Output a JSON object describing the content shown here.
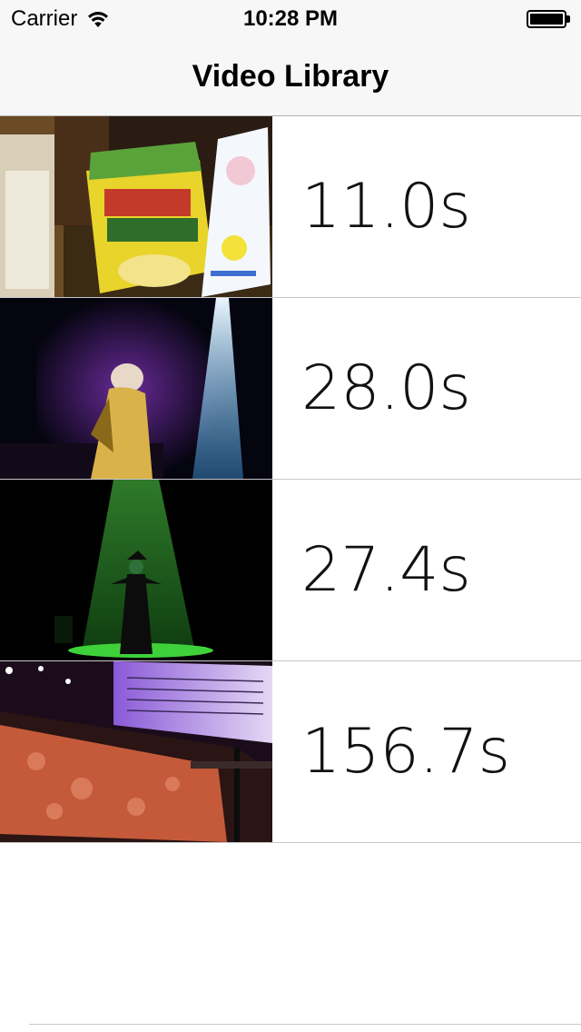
{
  "status_bar": {
    "carrier": "Carrier",
    "time": "10:28 PM",
    "icons": [
      "wifi-icon",
      "battery-icon"
    ]
  },
  "nav": {
    "title": "Video Library"
  },
  "videos": [
    {
      "duration": "11.0s",
      "thumbnail": "snack-packages-thumbnail"
    },
    {
      "duration": "28.0s",
      "thumbnail": "stage-spotlight-performer-thumbnail"
    },
    {
      "duration": "27.4s",
      "thumbnail": "green-spotlight-witch-thumbnail"
    },
    {
      "duration": "156.7s",
      "thumbnail": "stage-piano-sheet-music-thumbnail"
    }
  ],
  "colors": {
    "bar_background": "#f7f7f7",
    "separator": "#c8c7cc",
    "text": "#000000"
  }
}
